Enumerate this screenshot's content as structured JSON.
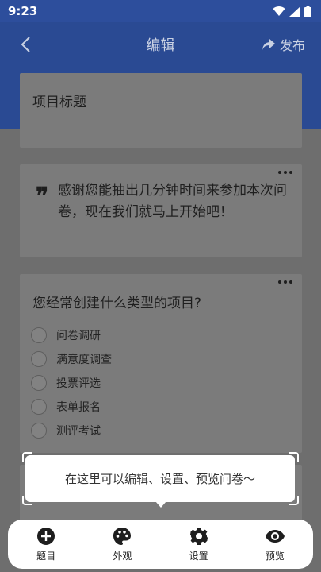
{
  "status_bar": {
    "time": "9:23"
  },
  "app_bar": {
    "title": "编辑",
    "publish_label": "发布"
  },
  "title_card": {
    "placeholder": "项目标题"
  },
  "intro_card": {
    "text": "感谢您能抽出几分钟时间来参加本次问卷，现在我们就马上开始吧！"
  },
  "question_card": {
    "question": "您经常创建什么类型的项目?",
    "options": [
      "问卷调研",
      "满意度调查",
      "投票评选",
      "表单报名",
      "测评考试"
    ]
  },
  "tooltip": {
    "text": "在这里可以编辑、设置、预览问卷～"
  },
  "bottom_nav": {
    "items": [
      {
        "label": "题目",
        "icon": "add-circle-icon"
      },
      {
        "label": "外观",
        "icon": "palette-icon"
      },
      {
        "label": "设置",
        "icon": "gear-icon"
      },
      {
        "label": "预览",
        "icon": "eye-icon"
      }
    ]
  },
  "colors": {
    "primary": "#2a4a93",
    "overlay": "#6e6e6e"
  }
}
